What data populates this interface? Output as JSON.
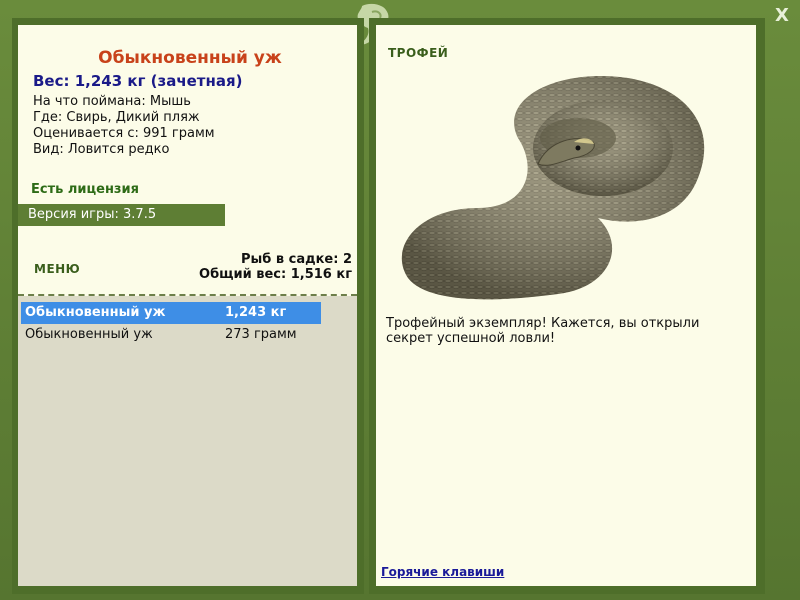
{
  "fish": {
    "title": "Обыкновенный уж",
    "weight_line": "Вес: 1,243 кг (зачетная)",
    "bait": "На что поймана: Мышь",
    "place": "Где: Свирь, Дикий пляж",
    "value_from": "Оценивается с: 991 грамм",
    "rarity": "Вид: Ловится редко"
  },
  "license": "Есть лицензия",
  "version": "Версия игры: 3.7.5",
  "menu_label": "МЕНЮ",
  "keepnet": {
    "count_line": "Рыб в садке: 2",
    "total_line": "Общий вес: 1,516 кг"
  },
  "catches": [
    {
      "name": "Обыкновенный уж",
      "weight": "1,243 кг",
      "selected": true
    },
    {
      "name": "Обыкновенный уж",
      "weight": "273 грамм",
      "selected": false
    }
  ],
  "trophy_label": "ТРОФЕЙ",
  "trophy_text": "Трофейный экземпляр! Кажется, вы открыли секрет успешной ловли!",
  "hotkeys_link": "Горячие клавиши",
  "close_label": "X",
  "colors": {
    "frame": "#567530",
    "panel": "#fcfce8",
    "list_bg": "#dcdac8",
    "selected_row": "#3e8ee6",
    "title": "#c8421a",
    "weight": "#1a1a88"
  }
}
